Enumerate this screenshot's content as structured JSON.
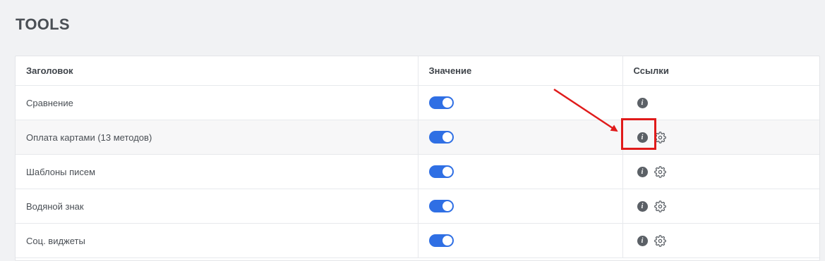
{
  "page": {
    "title": "TOOLS"
  },
  "table": {
    "headers": [
      "Заголовок",
      "Значение",
      "Ссылки"
    ],
    "rows": [
      {
        "label": "Сравнение",
        "enabled": true,
        "links": [
          "info-icon"
        ]
      },
      {
        "label": "Оплата картами (13 методов)",
        "enabled": true,
        "links": [
          "info-icon",
          "gear-icon"
        ]
      },
      {
        "label": "Шаблоны писем",
        "enabled": true,
        "links": [
          "info-icon",
          "gear-icon"
        ]
      },
      {
        "label": "Водяной знак",
        "enabled": true,
        "links": [
          "info-icon",
          "gear-icon"
        ]
      },
      {
        "label": "Соц. виджеты",
        "enabled": true,
        "links": [
          "info-icon",
          "gear-icon"
        ]
      }
    ]
  },
  "colors": {
    "toggle_on": "#2f6fe4",
    "annotation": "#e01b1b"
  }
}
